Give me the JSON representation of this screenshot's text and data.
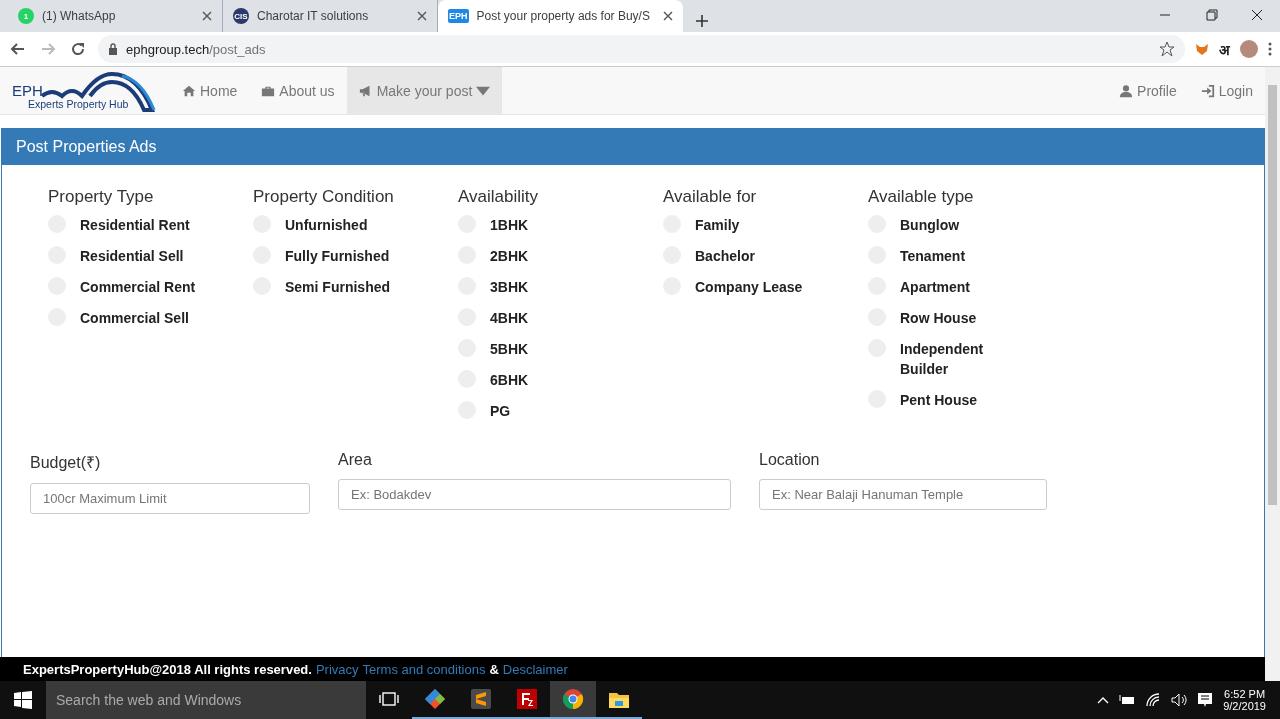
{
  "browser": {
    "tabs": [
      {
        "title": "(1) WhatsApp",
        "favicon": "1",
        "kind": "whatsapp",
        "selected": false
      },
      {
        "title": "Charotar IT solutions",
        "favicon": "CIS",
        "kind": "cis",
        "selected": false
      },
      {
        "title": "Post your property ads for Buy/S",
        "favicon": "EPH",
        "kind": "eph",
        "selected": true
      }
    ],
    "address": {
      "host": "ephgroup.tech",
      "path": "/post_ads"
    },
    "extension_label": "अ"
  },
  "site_nav": {
    "logo": {
      "short": "EPH",
      "name": "Experts Property Hub"
    },
    "items": [
      {
        "label": "Home",
        "selected": false,
        "dropdown": false
      },
      {
        "label": "About us",
        "selected": false,
        "dropdown": false
      },
      {
        "label": "Make your post",
        "selected": true,
        "dropdown": true
      }
    ],
    "right_items": [
      {
        "label": "Profile"
      },
      {
        "label": "Login"
      }
    ]
  },
  "panel": {
    "title": "Post Properties Ads",
    "option_groups": [
      {
        "heading": "Property Type",
        "options": [
          {
            "label": "Residential Rent",
            "checked": false
          },
          {
            "label": "Residential Sell",
            "checked": false
          },
          {
            "label": "Commercial Rent",
            "checked": false
          },
          {
            "label": "Commercial Sell",
            "checked": false
          }
        ]
      },
      {
        "heading": "Property Condition",
        "options": [
          {
            "label": "Unfurnished",
            "checked": false
          },
          {
            "label": "Fully Furnished",
            "checked": false
          },
          {
            "label": "Semi Furnished",
            "checked": false
          }
        ]
      },
      {
        "heading": "Availability",
        "options": [
          {
            "label": "1BHK",
            "checked": false
          },
          {
            "label": "2BHK",
            "checked": false
          },
          {
            "label": "3BHK",
            "checked": false
          },
          {
            "label": "4BHK",
            "checked": false
          },
          {
            "label": "5BHK",
            "checked": false
          },
          {
            "label": "6BHK",
            "checked": false
          },
          {
            "label": "PG",
            "checked": false
          }
        ]
      },
      {
        "heading": "Available for",
        "options": [
          {
            "label": "Family",
            "checked": false
          },
          {
            "label": "Bachelor",
            "checked": false
          },
          {
            "label": "Company Lease",
            "checked": false
          }
        ]
      },
      {
        "heading": "Available type",
        "options": [
          {
            "label": "Bunglow",
            "checked": false
          },
          {
            "label": "Tenament",
            "checked": false
          },
          {
            "label": "Apartment",
            "checked": false
          },
          {
            "label": "Row House",
            "checked": false
          },
          {
            "label": "Independent Builder",
            "checked": false
          },
          {
            "label": "Pent House",
            "checked": false
          }
        ]
      }
    ],
    "fields": [
      {
        "label": "Budget(₹)",
        "placeholder": "100cr Maximum Limit"
      },
      {
        "label": "Area",
        "placeholder": "Ex: Bodakdev"
      },
      {
        "label": "Location",
        "placeholder": "Ex: Near Balaji Hanuman Temple"
      }
    ]
  },
  "footer": {
    "copyright": "ExpertsPropertyHub@2018 All rights reserved.",
    "links": [
      {
        "label": "Privacy",
        "kind": "link"
      },
      {
        "label": "Terms and conditions",
        "kind": "link"
      },
      {
        "label": "&",
        "kind": "text"
      },
      {
        "label": "Desclaimer",
        "kind": "link"
      }
    ]
  },
  "taskbar": {
    "search_placeholder": "Search the web and Windows",
    "apps": [
      {
        "kind": "git",
        "selected": false
      },
      {
        "kind": "sublime",
        "selected": false
      },
      {
        "kind": "filezilla",
        "selected": false
      },
      {
        "kind": "chrome",
        "selected": true
      },
      {
        "kind": "explorer",
        "selected": false
      }
    ],
    "time": "6:52 PM",
    "date": "9/2/2019"
  }
}
